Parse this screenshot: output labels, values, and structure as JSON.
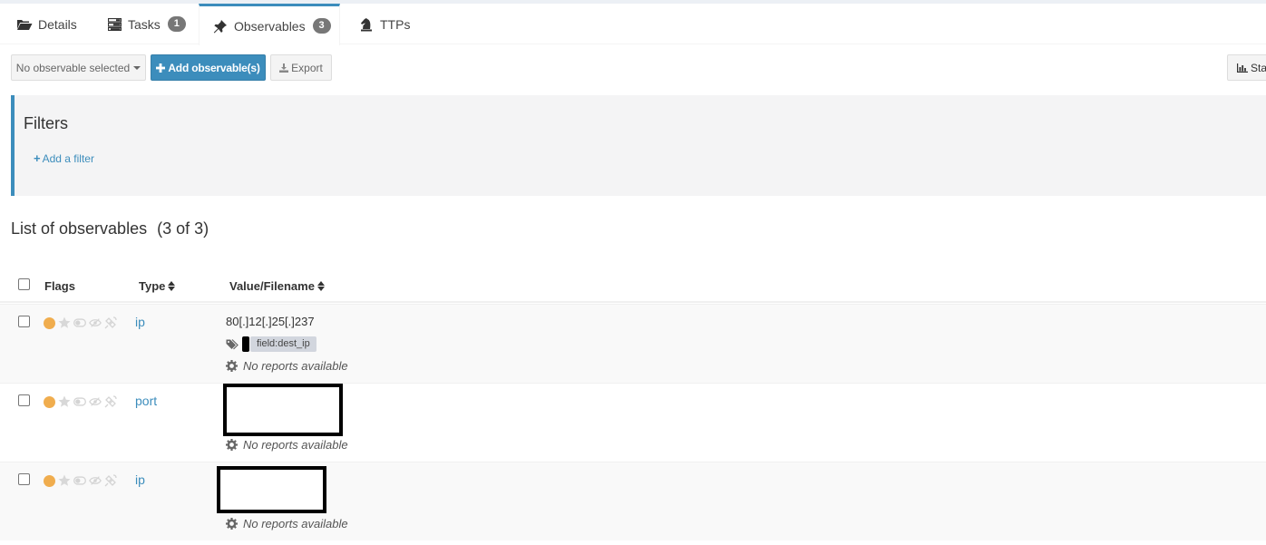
{
  "tabs": [
    {
      "label": "Details",
      "icon": "folder-open-icon"
    },
    {
      "label": "Tasks",
      "icon": "tasks-icon",
      "badge": "1"
    },
    {
      "label": "Observables",
      "icon": "pin-icon",
      "badge": "3",
      "active": true
    },
    {
      "label": "TTPs",
      "icon": "chess-knight-icon"
    }
  ],
  "toolbar": {
    "selection_label": "No observable selected",
    "add_label": "Add observable(s)",
    "export_label": "Export",
    "stats_label": "Sta"
  },
  "filters": {
    "title": "Filters",
    "add_filter_label": "Add a filter"
  },
  "list": {
    "title": "List of observables",
    "count": "(3 of 3)"
  },
  "table": {
    "headers": {
      "flags": "Flags",
      "type": "Type",
      "value": "Value/Filename"
    },
    "rows": [
      {
        "type": "ip",
        "value": "80[.]12[.]25[.]237",
        "tag": "field:dest_ip",
        "reports": "No reports available"
      },
      {
        "type": "port",
        "value": "",
        "reports": "No reports available"
      },
      {
        "type": "ip",
        "value": "",
        "reports": "No reports available"
      }
    ]
  },
  "colors": {
    "accent": "#3c8dbc",
    "tlp_dot": "#f0ad4e",
    "badge": "#777777",
    "tag_bg": "#d2d6de"
  }
}
